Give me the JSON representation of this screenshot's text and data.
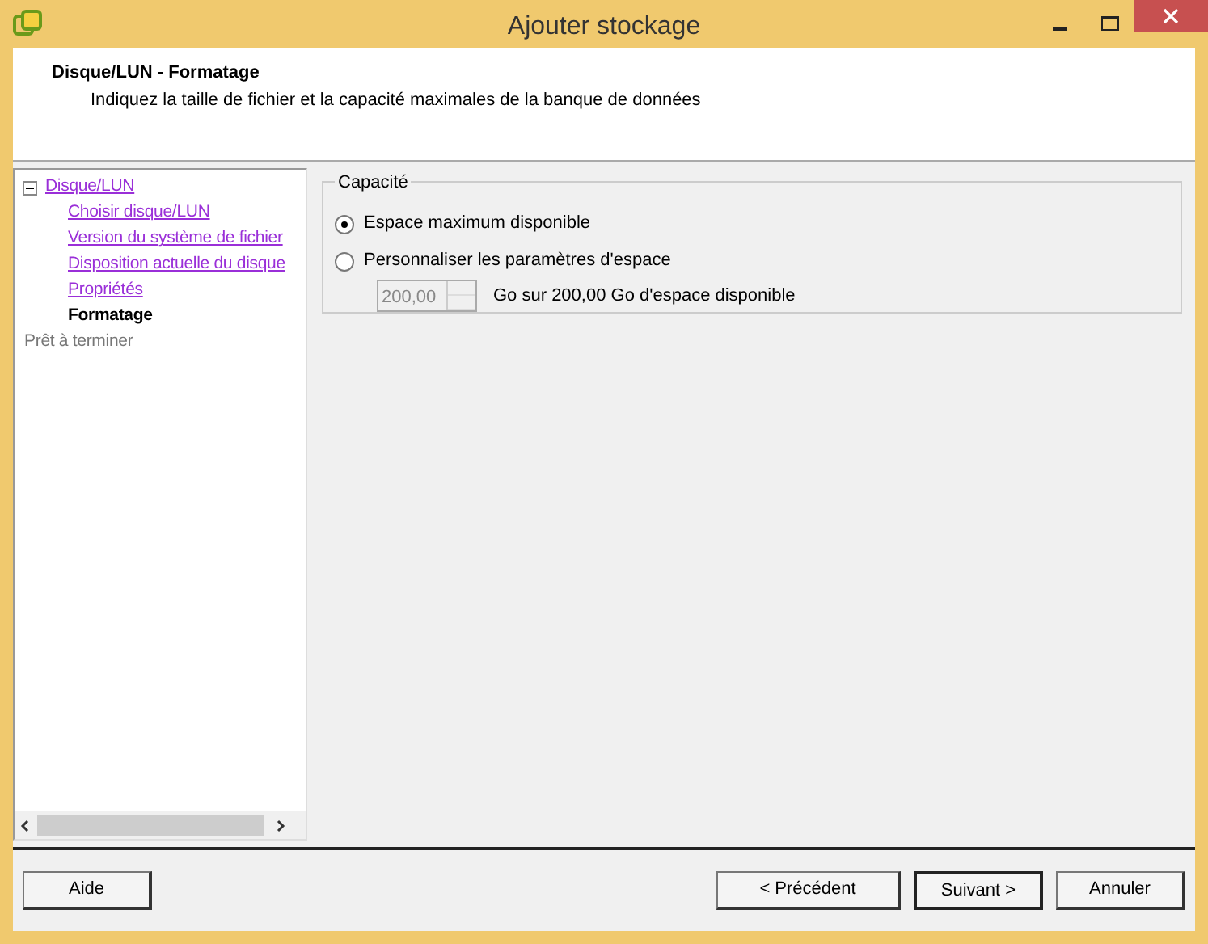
{
  "window": {
    "title": "Ajouter stockage"
  },
  "header": {
    "title": "Disque/LUN - Formatage",
    "subtitle": "Indiquez la taille de fichier et la capacité maximales de la banque de données"
  },
  "steps": [
    {
      "label": "Disque/LUN",
      "kind": "link",
      "expanded": true,
      "children": [
        {
          "label": "Choisir disque/LUN",
          "kind": "link"
        },
        {
          "label": "Version du système de fichier",
          "kind": "link"
        },
        {
          "label": "Disposition actuelle du disque",
          "kind": "link"
        },
        {
          "label": "Propriétés",
          "kind": "link"
        },
        {
          "label": "Formatage",
          "kind": "current"
        }
      ]
    },
    {
      "label": "Prêt à terminer",
      "kind": "pending"
    }
  ],
  "capacity": {
    "legend": "Capacité",
    "options": [
      {
        "label": "Espace maximum disponible",
        "selected": true
      },
      {
        "label": "Personnaliser les paramètres d'espace",
        "selected": false
      }
    ],
    "size": {
      "value": "200,00",
      "disabled": true,
      "note": "Go sur 200,00 Go d'espace disponible"
    }
  },
  "buttons": [
    {
      "label": "Aide",
      "kind": "help",
      "default": false
    },
    {
      "label": "< Précédent",
      "kind": "nav",
      "default": false
    },
    {
      "label": "Suivant >",
      "kind": "nav",
      "default": true
    },
    {
      "label": "Annuler",
      "kind": "nav",
      "default": false
    }
  ]
}
